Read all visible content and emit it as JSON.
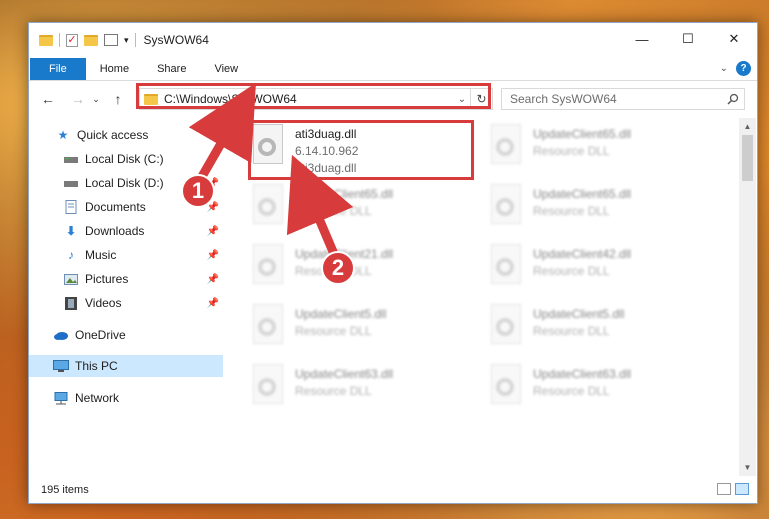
{
  "window": {
    "title": "SysWOW64"
  },
  "ribbon": {
    "tabs": [
      "File",
      "Home",
      "Share",
      "View"
    ]
  },
  "address": {
    "path": "C:\\Windows\\SysWOW64"
  },
  "search": {
    "placeholder": "Search SysWOW64"
  },
  "nav": {
    "items": [
      {
        "label": "Quick access",
        "icon": "star-icon",
        "pinned": false
      },
      {
        "label": "Local Disk (C:)",
        "icon": "drive-icon",
        "pinned": true
      },
      {
        "label": "Local Disk (D:)",
        "icon": "drive-icon",
        "pinned": true
      },
      {
        "label": "Documents",
        "icon": "document-icon",
        "pinned": true
      },
      {
        "label": "Downloads",
        "icon": "download-icon",
        "pinned": true
      },
      {
        "label": "Music",
        "icon": "music-icon",
        "pinned": true
      },
      {
        "label": "Pictures",
        "icon": "picture-icon",
        "pinned": true
      },
      {
        "label": "Videos",
        "icon": "video-icon",
        "pinned": true
      },
      {
        "label": "OneDrive",
        "icon": "cloud-icon",
        "pinned": false
      },
      {
        "label": "This PC",
        "icon": "computer-icon",
        "pinned": false
      },
      {
        "label": "Network",
        "icon": "network-icon",
        "pinned": false
      }
    ]
  },
  "files": [
    {
      "name": "ati3duag.dll",
      "line2": "6.14.10.962",
      "line3": "ati3duag.dll"
    },
    {
      "name": "UpdateClient65.dll",
      "line2": "Resource DLL"
    },
    {
      "name": "UpdateClient65.dll",
      "line2": "Resource DLL"
    },
    {
      "name": "UpdateClient65.dll",
      "line2": "Resource DLL"
    },
    {
      "name": "UpdateClient21.dll",
      "line2": "Resource DLL"
    },
    {
      "name": "UpdateClient42.dll",
      "line2": "Resource DLL"
    },
    {
      "name": "UpdateClient5.dll",
      "line2": "Resource DLL"
    },
    {
      "name": "UpdateClient5.dll",
      "line2": "Resource DLL"
    },
    {
      "name": "UpdateClient63.dll",
      "line2": "Resource DLL"
    },
    {
      "name": "UpdateClient63.dll",
      "line2": "Resource DLL"
    }
  ],
  "status": {
    "count": "195 items"
  },
  "annotations": {
    "step1": "1",
    "step2": "2",
    "color": "#d83b3b"
  }
}
